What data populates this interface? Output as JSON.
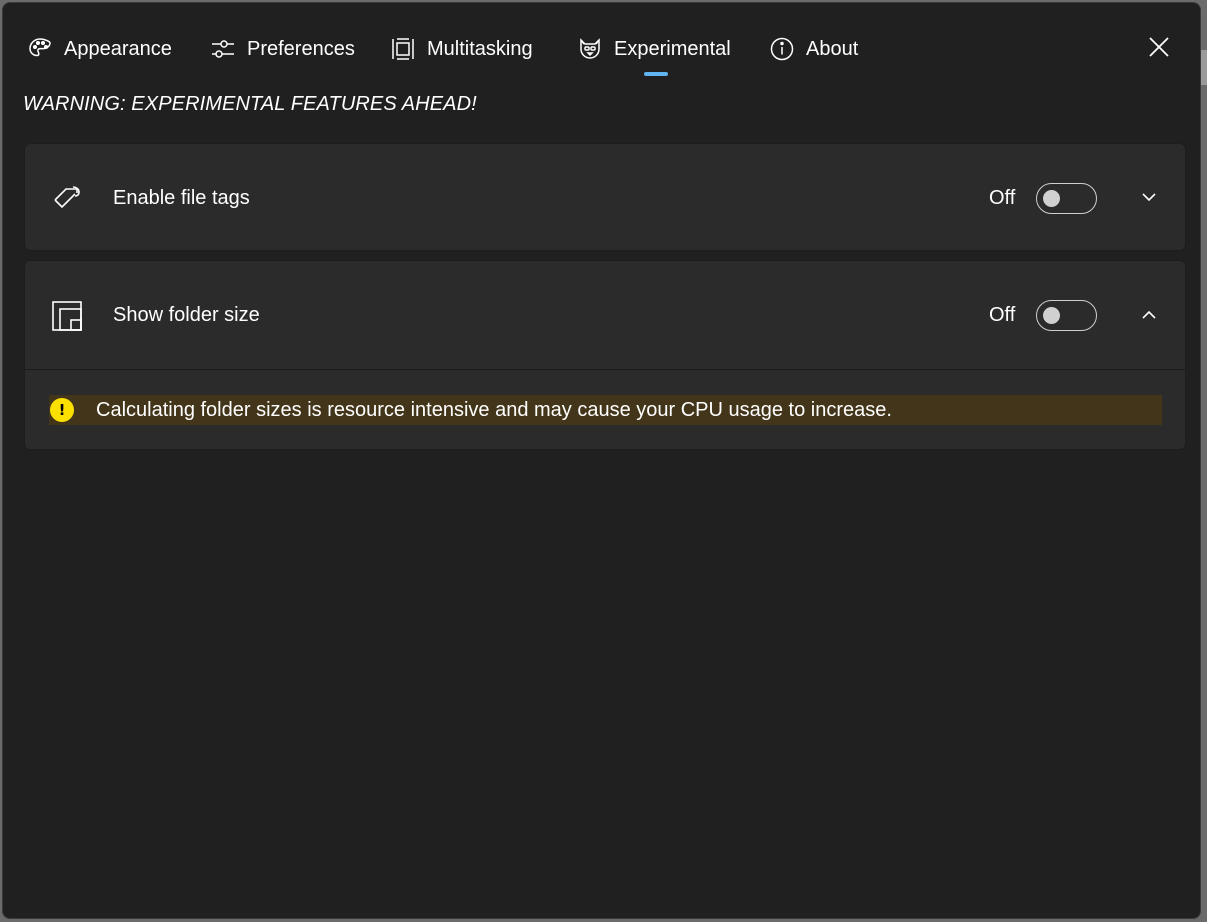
{
  "tabs": [
    {
      "label": "Appearance",
      "icon": "palette-icon"
    },
    {
      "label": "Preferences",
      "icon": "sliders-icon"
    },
    {
      "label": "Multitasking",
      "icon": "multitask-icon"
    },
    {
      "label": "Experimental",
      "icon": "cat-icon",
      "selected": true
    },
    {
      "label": "About",
      "icon": "info-icon"
    }
  ],
  "close_icon": "close-icon",
  "warning": "WARNING: EXPERIMENTAL FEATURES AHEAD!",
  "settings": [
    {
      "label": "Enable file tags",
      "state": "Off",
      "icon": "tag-icon",
      "expanded": false
    },
    {
      "label": "Show folder size",
      "state": "Off",
      "icon": "folder-size-icon",
      "expanded": true
    }
  ],
  "folder_size_info": {
    "icon": "!",
    "message": "Calculating folder sizes is resource intensive and may cause your CPU usage to increase."
  },
  "colors": {
    "background": "#202020",
    "card": "#2b2b2b",
    "accent": "#60b4f0",
    "info_bar": "#433519",
    "info_icon": "#fce100"
  }
}
